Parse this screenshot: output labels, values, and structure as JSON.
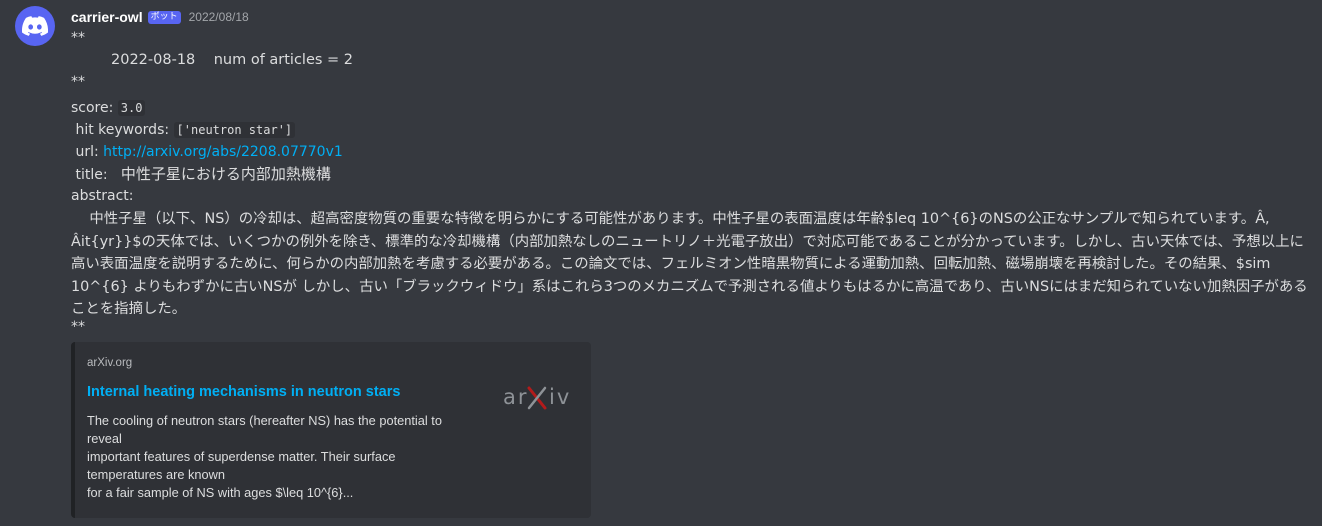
{
  "message": {
    "username": "carrier-owl",
    "bot_badge": "ボット",
    "timestamp": "2022/08/18",
    "bold_open": "**",
    "header_line": "2022-08-18    num of articles = 2",
    "bold_close": "**",
    "score_label": "score: ",
    "score_value": "3.0",
    "keywords_label": " hit keywords: ",
    "keywords_value": "['neutron star']",
    "url_label": " url: ",
    "url_value": "http://arxiv.org/abs/2208.07770v1",
    "title_label": " title:   ",
    "title_value": "中性子星における内部加熱機構",
    "abstract_label": " abstract:",
    "abstract_text": "    中性子星（以下、NS）の冷却は、超高密度物質の重要な特徴を明らかにする可能性があります。中性子星の表面温度は年齢$leq 10^{6}のNSの公正なサンプルで知られています。Â, Âit{yr}}$の天体では、いくつかの例外を除き、標準的な冷却機構（内部加熱なしのニュートリノ＋光電子放出）で対応可能であることが分かっています。しかし、古い天体では、予想以上に高い表面温度を説明するために、何らかの内部加熱を考慮する必要がある。この論文では、フェルミオン性暗黒物質による運動加熱、回転加熱、磁場崩壊を再検討した。その結果、$sim 10^{6} よりもわずかに古いNSが しかし、古い「ブラックウィドウ」系はこれら3つのメカニズムで予測される値よりもはるかに高温であり、古いNSにはまだ知られていない加熱因子があることを指摘した。",
    "trailing": " **"
  },
  "embed": {
    "provider": "arXiv.org",
    "title": "Internal heating mechanisms in neutron stars",
    "desc_line1": "The cooling of neutron stars (hereafter NS) has the potential to",
    "desc_line2": "reveal",
    "desc_line3": "important features of superdense matter. Their surface",
    "desc_line4": "temperatures are known",
    "desc_line5": "for a fair sample of NS with ages $\\leq 10^{6}...",
    "thumb_logo": "arXiv"
  },
  "colors": {
    "background": "#36393f",
    "embed_bg": "#2f3136",
    "link": "#00aff4",
    "brand": "#5865f2",
    "arxiv_red": "#b31b1b"
  },
  "icons": {
    "avatar": "discord-logo-icon",
    "thumbnail": "arxiv-logo-icon"
  }
}
